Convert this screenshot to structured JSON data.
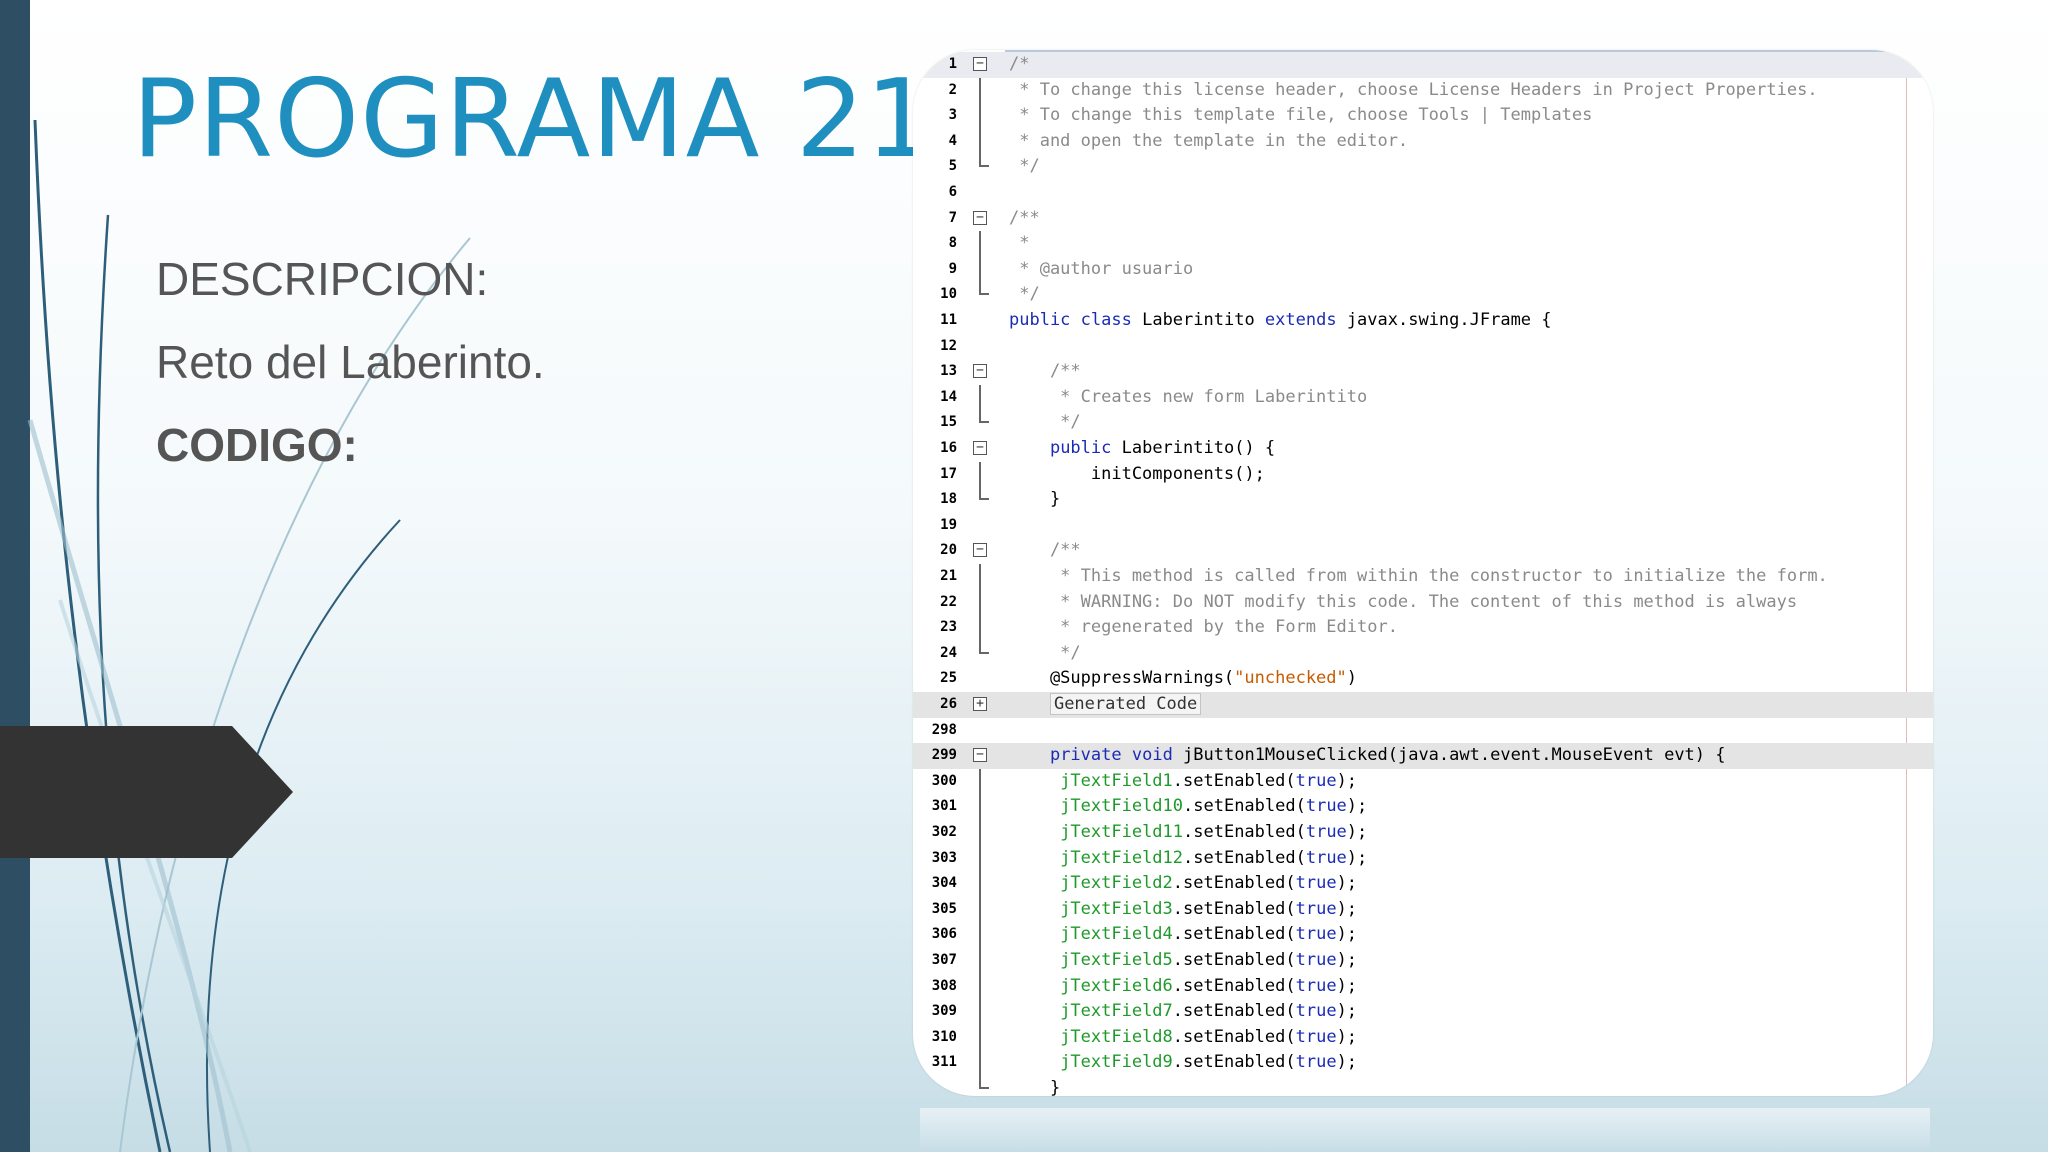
{
  "slide": {
    "title": "PROGRAMA 21",
    "description_label": "DESCRIPCION:",
    "description_value": "Reto del Laberinto.",
    "code_label": "CODIGO:"
  },
  "colors": {
    "title": "#1f8fbf",
    "sidebar": "#2e4f63",
    "arrow": "#333333",
    "keyword": "#1a2bb5",
    "field": "#1e9a2a",
    "comment": "#8a8a8a",
    "string": "#c85a00"
  },
  "editor": {
    "lines": [
      {
        "n": "1",
        "t": "/*",
        "fold": "start"
      },
      {
        "n": "2",
        "t": " * To change this license header, choose License Headers in Project Properties.",
        "fold": "line"
      },
      {
        "n": "3",
        "t": " * To change this template file, choose Tools | Templates",
        "fold": "line"
      },
      {
        "n": "4",
        "t": " * and open the template in the editor.",
        "fold": "line"
      },
      {
        "n": "5",
        "t": " */",
        "fold": "end"
      },
      {
        "n": "6",
        "t": ""
      },
      {
        "n": "7",
        "t": "/**",
        "fold": "start"
      },
      {
        "n": "8",
        "t": " *",
        "fold": "line"
      },
      {
        "n": "9",
        "t": " * @author usuario",
        "fold": "line"
      },
      {
        "n": "10",
        "t": " */",
        "fold": "end"
      },
      {
        "n": "11",
        "t": "public class Laberintito extends javax.swing.JFrame {"
      },
      {
        "n": "12",
        "t": ""
      },
      {
        "n": "13",
        "t": "    /**",
        "fold": "start"
      },
      {
        "n": "14",
        "t": "     * Creates new form Laberintito",
        "fold": "line"
      },
      {
        "n": "15",
        "t": "     */",
        "fold": "end"
      },
      {
        "n": "16",
        "t": "    public Laberintito() {",
        "fold": "start"
      },
      {
        "n": "17",
        "t": "        initComponents();",
        "fold": "line"
      },
      {
        "n": "18",
        "t": "    }",
        "fold": "end"
      },
      {
        "n": "19",
        "t": ""
      },
      {
        "n": "20",
        "t": "    /**",
        "fold": "start"
      },
      {
        "n": "21",
        "t": "     * This method is called from within the constructor to initialize the form.",
        "fold": "line"
      },
      {
        "n": "22",
        "t": "     * WARNING: Do NOT modify this code. The content of this method is always",
        "fold": "line"
      },
      {
        "n": "23",
        "t": "     * regenerated by the Form Editor.",
        "fold": "line"
      },
      {
        "n": "24",
        "t": "     */",
        "fold": "end"
      },
      {
        "n": "25",
        "t": "    @SuppressWarnings(\"unchecked\")"
      },
      {
        "n": "26",
        "t": "    Generated Code",
        "fold": "plus"
      },
      {
        "n": "298",
        "t": ""
      },
      {
        "n": "299",
        "t": "    private void jButton1MouseClicked(java.awt.event.MouseEvent evt) {",
        "fold": "start"
      },
      {
        "n": "300",
        "t": "     jTextField1.setEnabled(true);",
        "fold": "line"
      },
      {
        "n": "301",
        "t": "     jTextField10.setEnabled(true);",
        "fold": "line"
      },
      {
        "n": "302",
        "t": "     jTextField11.setEnabled(true);",
        "fold": "line"
      },
      {
        "n": "303",
        "t": "     jTextField12.setEnabled(true);",
        "fold": "line"
      },
      {
        "n": "304",
        "t": "     jTextField2.setEnabled(true);",
        "fold": "line"
      },
      {
        "n": "305",
        "t": "     jTextField3.setEnabled(true);",
        "fold": "line"
      },
      {
        "n": "306",
        "t": "     jTextField4.setEnabled(true);",
        "fold": "line"
      },
      {
        "n": "307",
        "t": "     jTextField5.setEnabled(true);",
        "fold": "line"
      },
      {
        "n": "308",
        "t": "     jTextField6.setEnabled(true);",
        "fold": "line"
      },
      {
        "n": "309",
        "t": "     jTextField7.setEnabled(true);",
        "fold": "line"
      },
      {
        "n": "310",
        "t": "     jTextField8.setEnabled(true);",
        "fold": "line"
      },
      {
        "n": "311",
        "t": "     jTextField9.setEnabled(true);",
        "fold": "line"
      },
      {
        "n": "",
        "t": "    }",
        "fold": "end"
      }
    ]
  }
}
